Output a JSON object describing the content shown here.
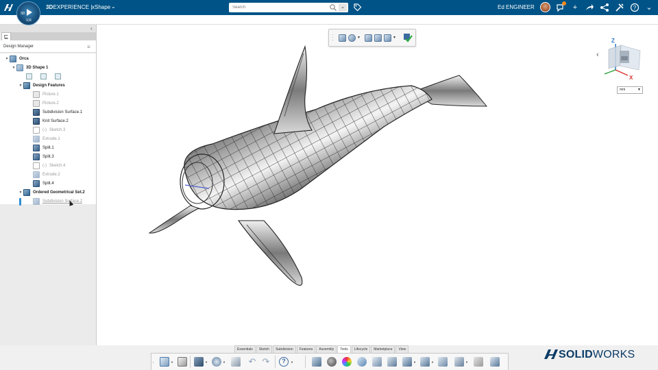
{
  "header": {
    "brand_bold": "3D",
    "brand_rest": "EXPERIENCE |",
    "app_name": "xShape",
    "compass_label_3d": "3D",
    "compass_label_vr": "V,R",
    "search_placeholder": "Search",
    "user_name": "Ed ENGINEER",
    "brand_color": "#005386"
  },
  "design_manager": {
    "title": "Design Manager",
    "tree": [
      {
        "label": "Orca",
        "style": "bold",
        "icon": "body-icon"
      },
      {
        "label": "3D Shape 1",
        "style": "bold",
        "icon": "shape-icon"
      },
      {
        "label": "Design Features",
        "style": "bold",
        "icon": "features-icon"
      },
      {
        "label": "Picture.1",
        "style": "dim",
        "icon": "picture-icon"
      },
      {
        "label": "Picture.2",
        "style": "dim",
        "icon": "picture-icon"
      },
      {
        "label": "Subdivision Surface.1",
        "style": "normal",
        "icon": "subdivision-icon"
      },
      {
        "label": "Knit Surface.2",
        "style": "normal",
        "icon": "knit-icon"
      },
      {
        "label": "Sketch.3",
        "style": "dim",
        "icon": "sketch-icon",
        "prefix": "(-)"
      },
      {
        "label": "Extrude.1",
        "style": "dim",
        "icon": "extrude-icon"
      },
      {
        "label": "Split.1",
        "style": "normal",
        "icon": "split-icon"
      },
      {
        "label": "Split.3",
        "style": "normal",
        "icon": "split-icon"
      },
      {
        "label": "Sketch.4",
        "style": "dim",
        "icon": "sketch-icon",
        "prefix": "(-)"
      },
      {
        "label": "Extrude.2",
        "style": "dim",
        "icon": "extrude-icon"
      },
      {
        "label": "Split.4",
        "style": "normal",
        "icon": "split-icon"
      },
      {
        "label": "Ordered Geometrical Set.2",
        "style": "bold",
        "icon": "geoset-icon"
      },
      {
        "label": "Subdivision Surface.2",
        "style": "selected",
        "icon": "subdivision-icon"
      }
    ]
  },
  "viewport": {
    "unit": "mm",
    "axis_z": "Z",
    "axis_x": "X"
  },
  "ribbon": {
    "tabs": [
      "Essentials",
      "Sketch",
      "Subdivision",
      "Features",
      "Assembly",
      "Tools",
      "Lifecycle",
      "Marketplace",
      "View"
    ],
    "active_tab": "Tools"
  },
  "footer": {
    "logo_bold": "SOLID",
    "logo_rest": "WORKS"
  }
}
